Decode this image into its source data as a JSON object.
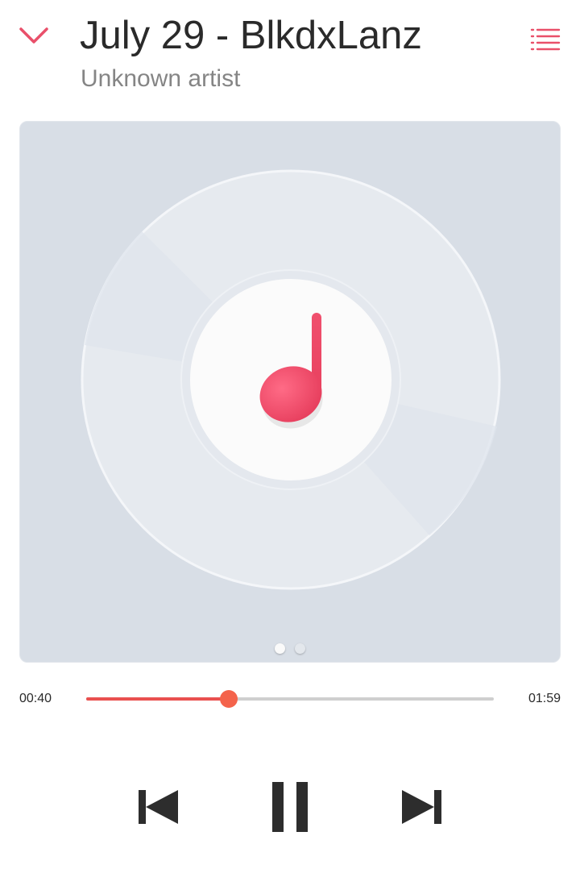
{
  "header": {
    "title": "July 29 - BlkdxLanz",
    "artist": "Unknown artist",
    "collapse_icon": "chevron-down-icon",
    "queue_icon": "playlist-icon"
  },
  "artwork": {
    "placeholder_icon": "music-note-icon",
    "pages": 2,
    "active_page": 1
  },
  "playback": {
    "elapsed": "00:40",
    "total": "01:59",
    "progress": 0.35,
    "state": "playing"
  },
  "controls": {
    "previous_icon": "skip-previous-icon",
    "pause_icon": "pause-icon",
    "next_icon": "skip-next-icon"
  },
  "colors": {
    "accent": "#e9506a",
    "progress": "#e9504f",
    "thumb": "#f4634b",
    "panel_bg": "#d8dee6",
    "control": "#2d2d2d"
  }
}
